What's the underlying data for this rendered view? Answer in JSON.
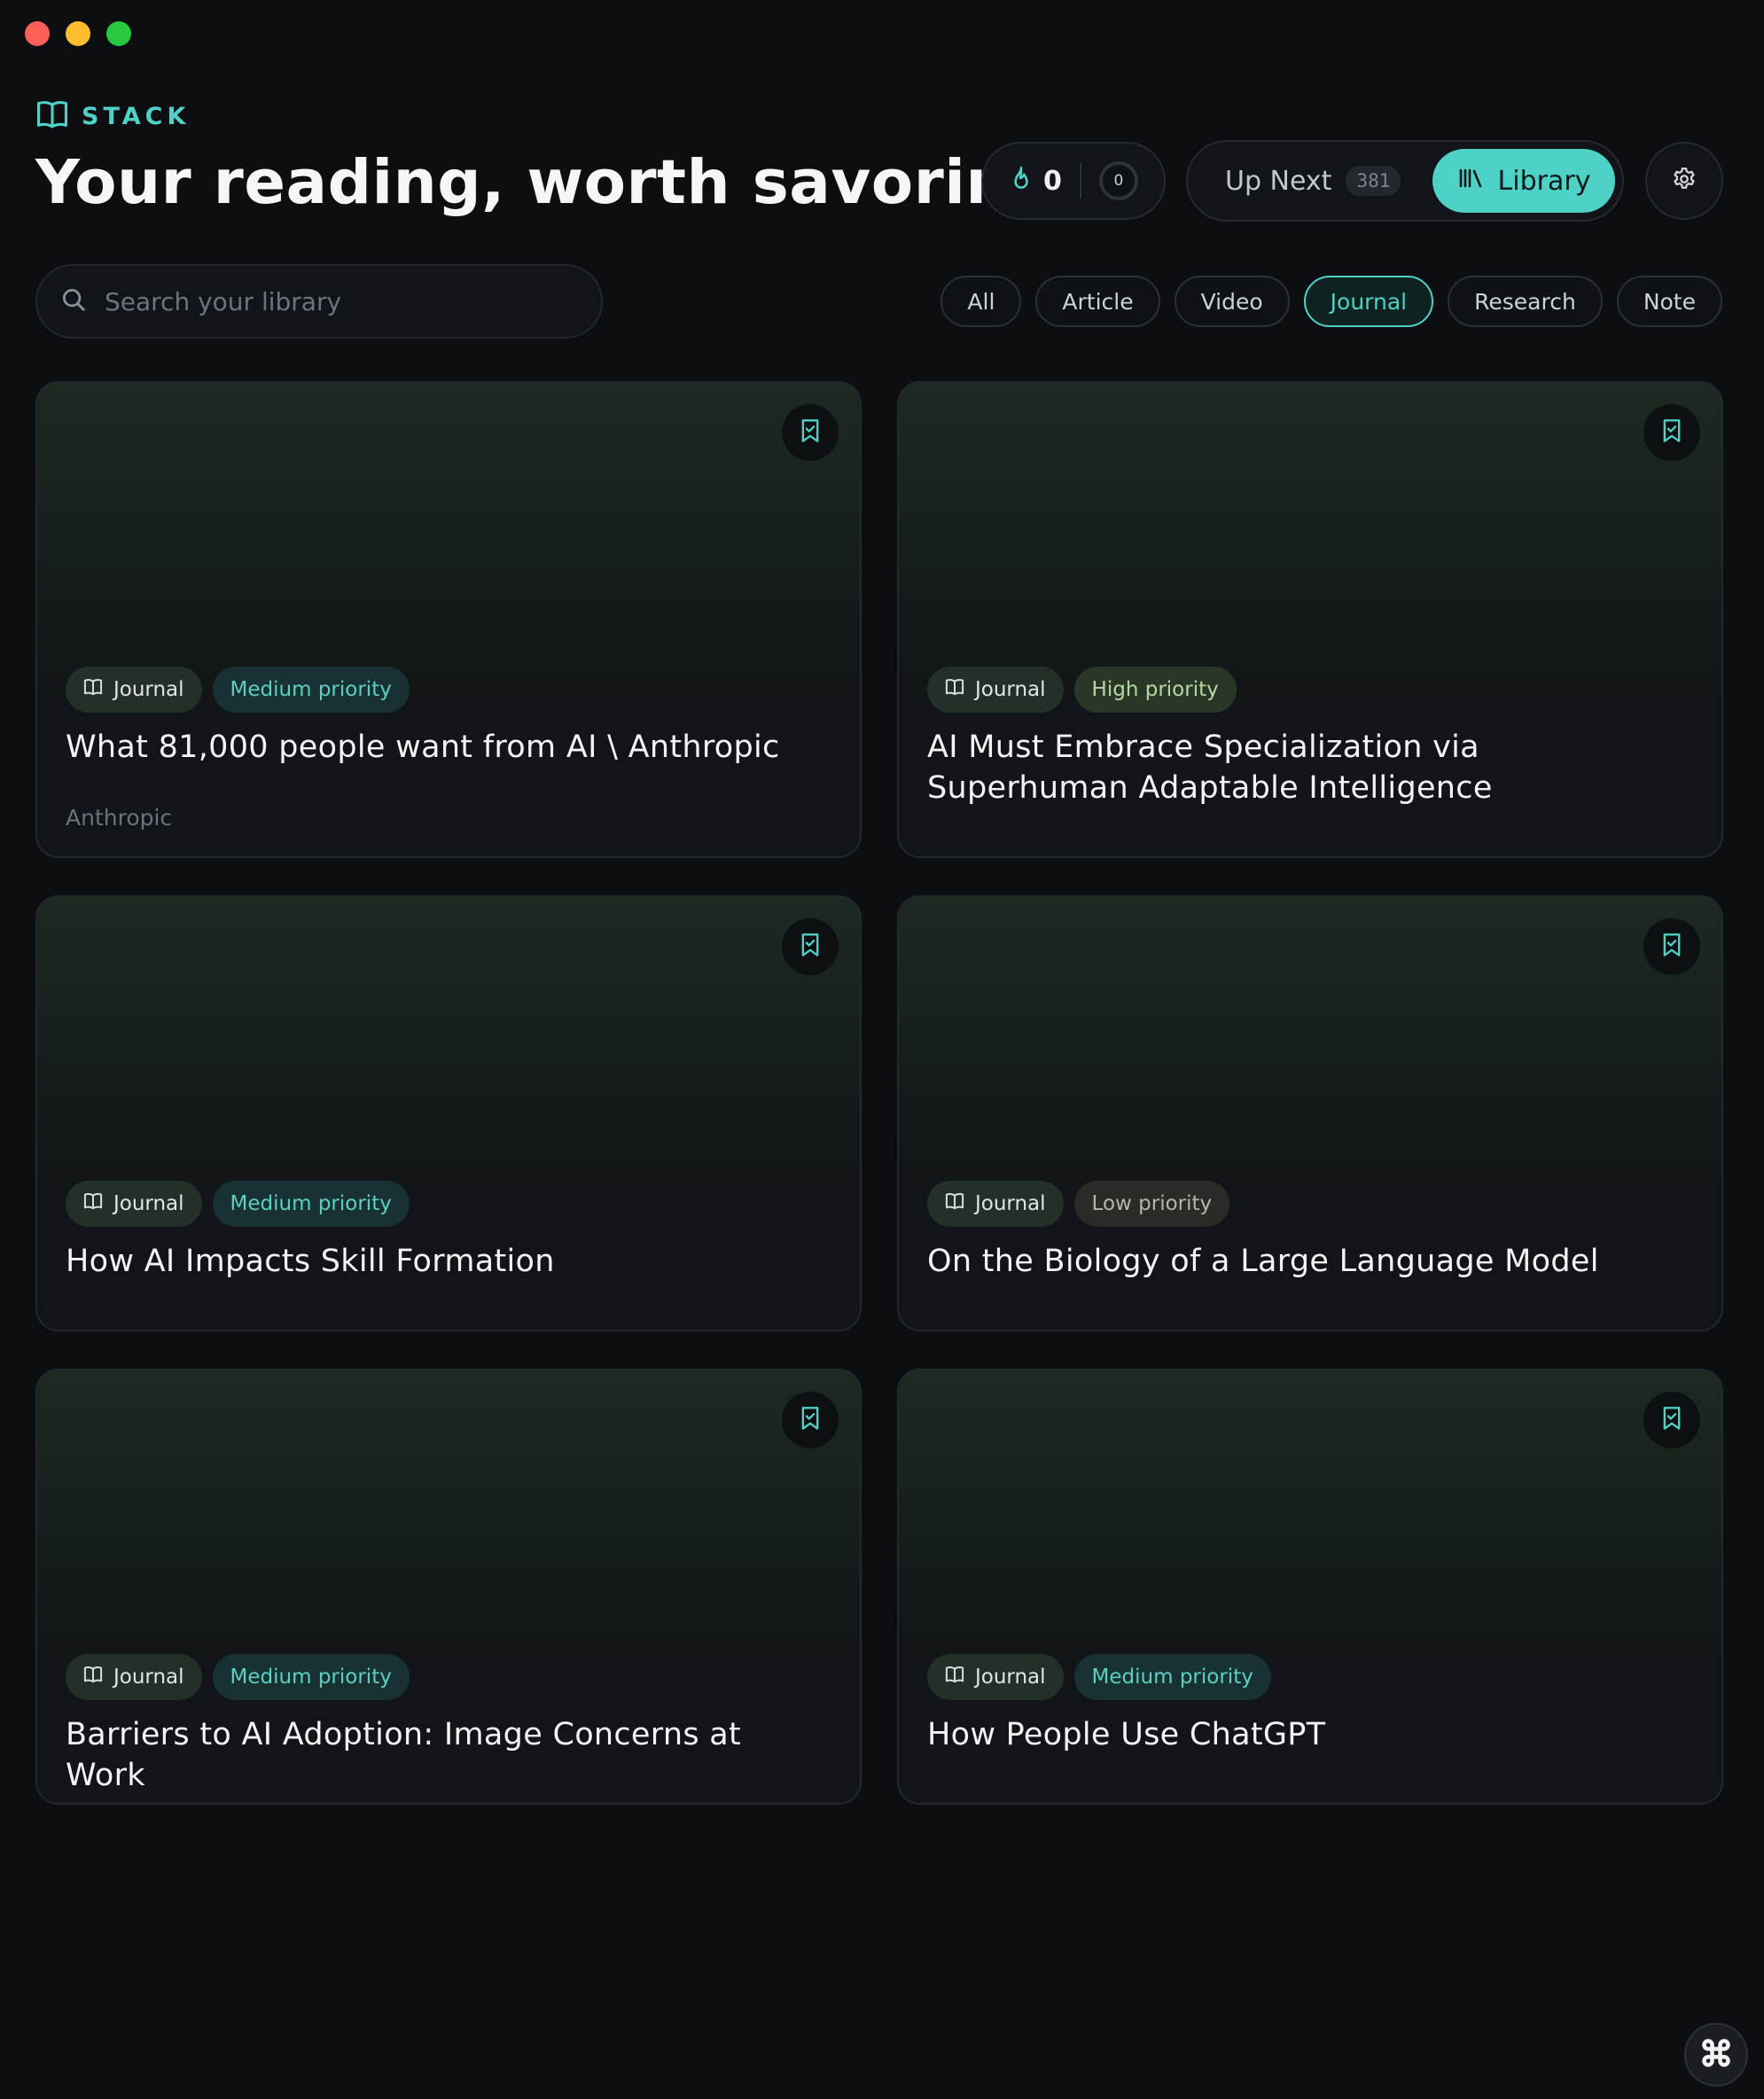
{
  "brand": {
    "name": "STACK"
  },
  "headline": "Your reading, worth savoring.",
  "streak": {
    "count": "0",
    "ring_value": "0"
  },
  "view_toggle": {
    "up_next_label": "Up Next",
    "up_next_count": "381",
    "library_label": "Library",
    "active": "Library"
  },
  "search": {
    "placeholder": "Search your library",
    "value": ""
  },
  "filters": [
    {
      "label": "All",
      "active": false
    },
    {
      "label": "Article",
      "active": false
    },
    {
      "label": "Video",
      "active": false
    },
    {
      "label": "Journal",
      "active": true
    },
    {
      "label": "Research",
      "active": false
    },
    {
      "label": "Note",
      "active": false
    }
  ],
  "cards": [
    {
      "type": "Journal",
      "priority": "Medium priority",
      "title": "What 81,000 people want from AI \\ Anthropic",
      "source": "Anthropic"
    },
    {
      "type": "Journal",
      "priority": "High priority",
      "title": "AI Must Embrace Specialization via Superhuman Adaptable Intelligence",
      "source": ""
    },
    {
      "type": "Journal",
      "priority": "Medium priority",
      "title": "How AI Impacts Skill Formation",
      "source": ""
    },
    {
      "type": "Journal",
      "priority": "Low priority",
      "title": "On the Biology of a Large Language Model",
      "source": ""
    },
    {
      "type": "Journal",
      "priority": "Medium priority",
      "title": "Barriers to AI Adoption: Image Concerns at Work",
      "source": ""
    },
    {
      "type": "Journal",
      "priority": "Medium priority",
      "title": "How People Use ChatGPT",
      "source": ""
    }
  ],
  "colors": {
    "accent": "#4fd1c5",
    "background": "#0c0e12",
    "card": "#111418",
    "medium_priority": "#5ccfc3",
    "high_priority": "#b8d7a2",
    "low_priority": "#b7b4ab"
  },
  "icons": {
    "brand": "open-book-icon",
    "streak": "flame-icon",
    "library": "library-books-icon",
    "settings": "gear-icon",
    "search": "search-icon",
    "card_type": "open-book-icon",
    "save": "bookmark-check-icon",
    "fab": "command-key-icon"
  }
}
